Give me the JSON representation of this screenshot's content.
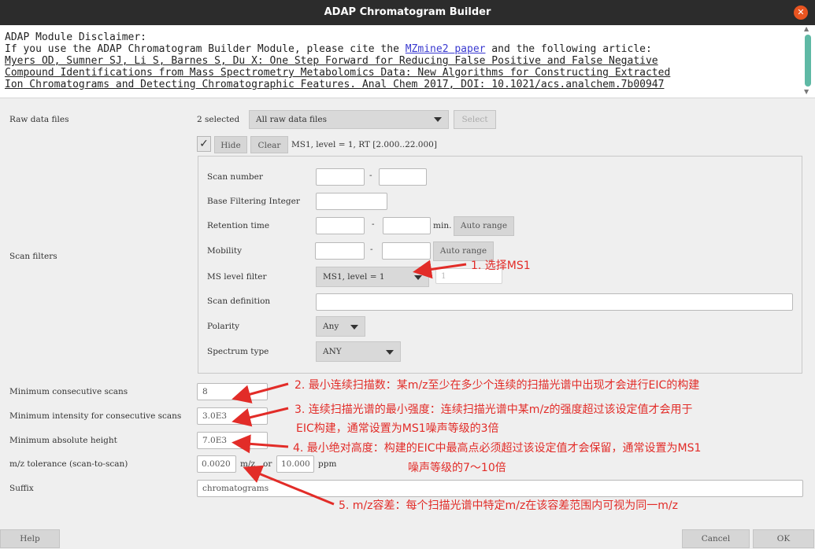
{
  "window": {
    "title": "ADAP Chromatogram Builder",
    "close_icon": "close-icon",
    "accent": "#e95420"
  },
  "disclaimer": {
    "line1": "ADAP Module Disclaimer:",
    "line2_pre": "If you use the ADAP Chromatogram Builder Module, please cite the ",
    "line2_link": "MZmine2 paper",
    "line2_post": " and the following article:",
    "ref1": "Myers OD, Sumner SJ, Li S, Barnes S, Du X: One Step Forward for Reducing False Positive and False Negative ",
    "ref2": "Compound Identifications from Mass Spectrometry Metabolomics Data: New Algorithms for Constructing Extracted ",
    "ref3": "Ion Chromatograms and Detecting Chromatographic Features. Anal Chem 2017, DOI: 10.1021/acs.analchem.7b00947"
  },
  "raw_data": {
    "label": "Raw data files",
    "count": "2 selected",
    "combo": "All raw data files",
    "select_btn": "Select"
  },
  "scan_filters": {
    "label": "Scan filters",
    "hide_btn": "Hide",
    "clear_btn": "Clear",
    "summary": "MS1, level = 1, RT [2.000..22.000]",
    "scan_number": "Scan number",
    "base_filter": "Base Filtering Integer",
    "retention_time": "Retention time",
    "dash": "-",
    "min_unit": "min.",
    "auto_range": "Auto range",
    "mobility": "Mobility",
    "ms_level": "MS level filter",
    "ms_level_value": "MS1, level = 1",
    "ms_level_num": "1",
    "scan_definition": "Scan definition",
    "polarity": "Polarity",
    "polarity_value": "Any",
    "spectrum_type": "Spectrum type",
    "spectrum_value": "ANY"
  },
  "params": {
    "min_consec_label": "Minimum consecutive scans",
    "min_consec_value": "8",
    "min_intensity_label": "Minimum intensity for consecutive scans",
    "min_intensity_value": "3.0E3",
    "min_height_label": "Minimum absolute height",
    "min_height_value": "7.0E3",
    "mz_tol_label": "m/z tolerance (scan-to-scan)",
    "mz_tol_value": "0.0020",
    "mz_unit": "m/z",
    "or": "or",
    "ppm_value": "10.000",
    "ppm_unit": "ppm",
    "suffix_label": "Suffix",
    "suffix_value": "chromatograms"
  },
  "annotations": {
    "a1": "1. 选择MS1",
    "a2": "2. 最小连续扫描数：某m/z至少在多少个连续的扫描光谱中出现才会进行EIC的构建",
    "a3_1": "3. 连续扫描光谱的最小强度：连续扫描光谱中某m/z的强度超过该设定值才会用于",
    "a3_2": "EIC构建，通常设置为MS1噪声等级的3倍",
    "a4_1": "4. 最小绝对高度：构建的EIC中最高点必须超过该设定值才会保留，通常设置为MS1",
    "a4_2": "噪声等级的7～10倍",
    "a5": "5. m/z容差：每个扫描光谱中特定m/z在该容差范围内可视为同一m/z",
    "color": "#e22c28"
  },
  "footer": {
    "help": "Help",
    "cancel": "Cancel",
    "ok": "OK"
  }
}
